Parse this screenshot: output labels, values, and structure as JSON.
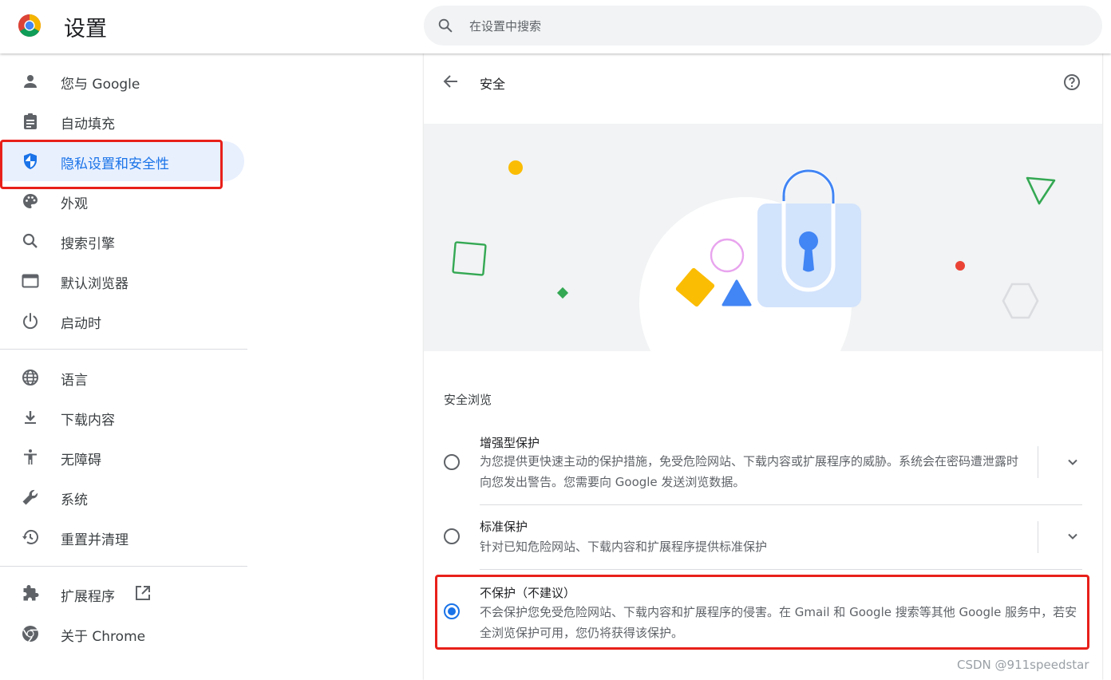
{
  "header": {
    "title": "设置",
    "search_placeholder": "在设置中搜索"
  },
  "sidebar": {
    "items": [
      {
        "label": "您与 Google",
        "icon": "person-icon"
      },
      {
        "label": "自动填充",
        "icon": "clipboard-icon"
      },
      {
        "label": "隐私设置和安全性",
        "icon": "shield-icon",
        "active": true
      },
      {
        "label": "外观",
        "icon": "palette-icon"
      },
      {
        "label": "搜索引擎",
        "icon": "search-icon"
      },
      {
        "label": "默认浏览器",
        "icon": "browser-window-icon"
      },
      {
        "label": "启动时",
        "icon": "power-icon"
      },
      {
        "label": "语言",
        "icon": "globe-icon"
      },
      {
        "label": "下载内容",
        "icon": "download-icon"
      },
      {
        "label": "无障碍",
        "icon": "accessibility-icon"
      },
      {
        "label": "系统",
        "icon": "wrench-icon"
      },
      {
        "label": "重置并清理",
        "icon": "history-icon"
      },
      {
        "label": "扩展程序",
        "icon": "puzzle-icon"
      },
      {
        "label": "关于 Chrome",
        "icon": "chrome-icon"
      }
    ]
  },
  "main": {
    "page_title": "安全",
    "section_title": "安全浏览",
    "options": [
      {
        "title": "增强型保护",
        "description": "为您提供更快速主动的保护措施，免受危险网站、下载内容或扩展程序的威胁。系统会在密码遭泄露时向您发出警告。您需要向 Google 发送浏览数据。",
        "selected": false
      },
      {
        "title": "标准保护",
        "description": "针对已知危险网站、下载内容和扩展程序提供标准保护",
        "selected": false
      },
      {
        "title": "不保护（不建议）",
        "description": "不会保护您免受危险网站、下载内容和扩展程序的侵害。在 Gmail 和 Google 搜索等其他 Google 服务中，若安全浏览保护可用，您仍将获得该保护。",
        "selected": true
      }
    ]
  },
  "watermark": "CSDN @911speedstar",
  "colors": {
    "accent": "#1a73e8",
    "active_bg": "#e8f0fe",
    "highlight": "#e8201a"
  }
}
